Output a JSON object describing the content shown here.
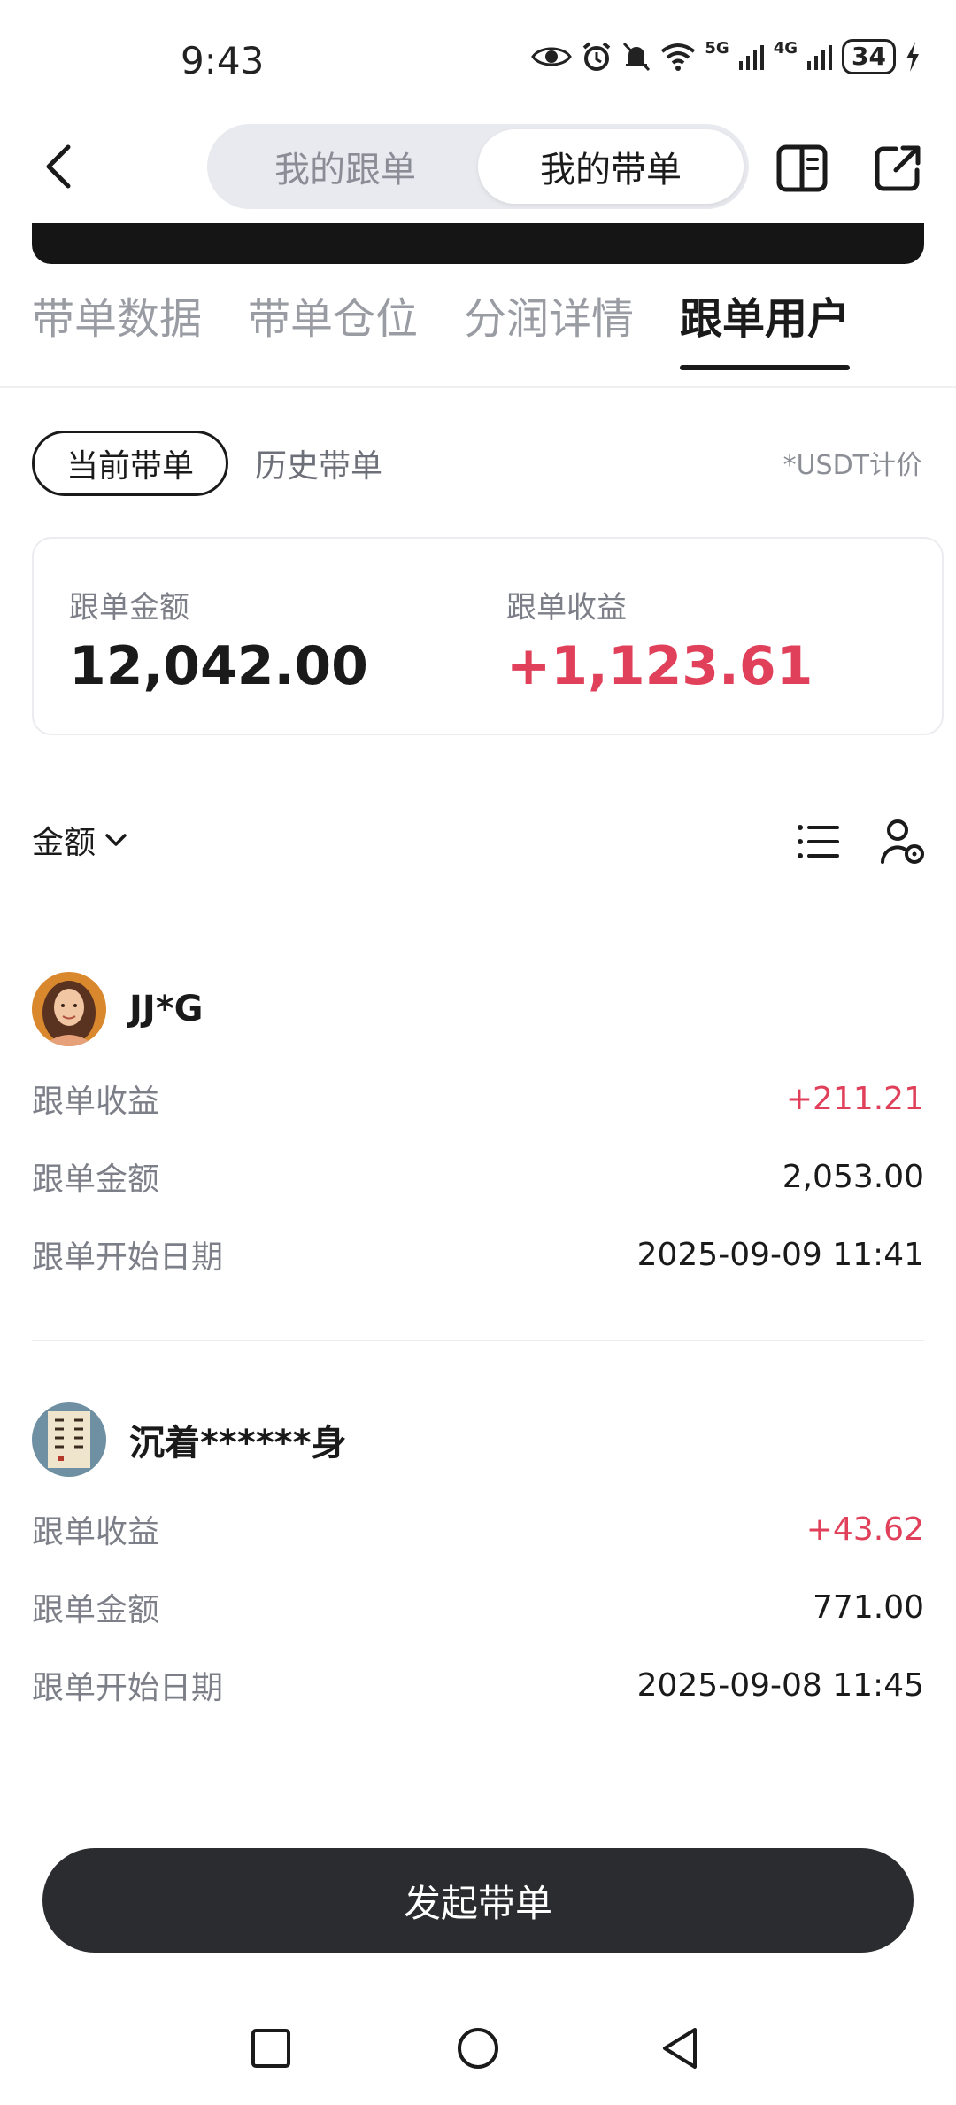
{
  "status_bar": {
    "time": "9:43",
    "network_labels": [
      "5G",
      "4G"
    ],
    "battery": "34"
  },
  "header": {
    "segments": [
      {
        "label": "我的跟单",
        "active": false
      },
      {
        "label": "我的带单",
        "active": true
      }
    ]
  },
  "tabs": [
    {
      "label": "带单数据",
      "active": false
    },
    {
      "label": "带单仓位",
      "active": false
    },
    {
      "label": "分润详情",
      "active": false
    },
    {
      "label": "跟单用户",
      "active": true
    }
  ],
  "filters": {
    "current_label": "当前带单",
    "history_label": "历史带单",
    "currency_note": "*USDT计价"
  },
  "summary": {
    "amount_label": "跟单金额",
    "amount_value": "12,042.00",
    "profit_label": "跟单收益",
    "profit_value": "+1,123.61",
    "profit_color": "#e0405a"
  },
  "sort": {
    "label": "金额"
  },
  "users": [
    {
      "name": "JJ*G",
      "profit_label": "跟单收益",
      "profit": "+211.21",
      "amount_label": "跟单金额",
      "amount": "2,053.00",
      "start_label": "跟单开始日期",
      "start": "2025-09-09 11:41"
    },
    {
      "name": "沉着******身",
      "profit_label": "跟单收益",
      "profit": "+43.62",
      "amount_label": "跟单金额",
      "amount": "771.00",
      "start_label": "跟单开始日期",
      "start": "2025-09-08 11:45"
    }
  ],
  "launch_button": "发起带单",
  "icons": {
    "back": "chevron-left-icon",
    "book": "book-icon",
    "share": "share-icon",
    "list": "list-icon",
    "user_settings": "user-settings-icon"
  }
}
